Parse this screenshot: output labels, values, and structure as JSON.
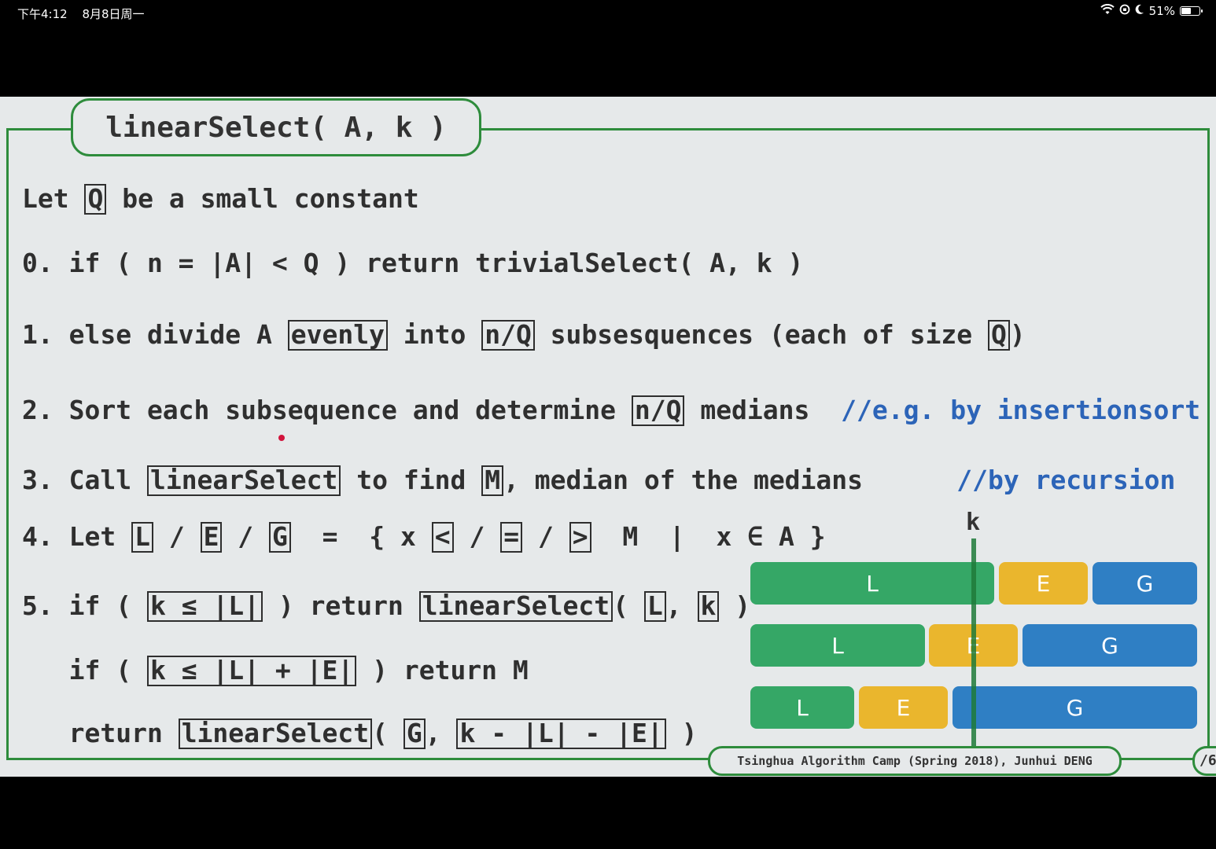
{
  "status": {
    "time": "下午4:12",
    "date": "8月8日周一",
    "battery": "51%"
  },
  "slide": {
    "title": "linearSelect( A, k )",
    "line_let": {
      "a": "Let ",
      "b": "Q",
      "c": " be a small constant"
    },
    "line0": "0. if ( n = |A| < Q ) return trivialSelect( A, k )",
    "line1": {
      "a": "1. else divide A ",
      "b": "evenly",
      "c": " into ",
      "d": "n/Q",
      "e": " subsesquences (each of size ",
      "f": "Q",
      "g": ")"
    },
    "line2": {
      "a": "2. Sort each subsequence and determine ",
      "b": "n/Q",
      "c": " medians  ",
      "comment": "//e.g. by insertionsort"
    },
    "line3": {
      "a": "3. Call ",
      "b": "linearSelect",
      "c": " to find ",
      "d": "M",
      "e": ", median of the medians      ",
      "comment": "//by recursion"
    },
    "line4": {
      "a": "4. Let ",
      "L": "L",
      "s1": " / ",
      "E": "E",
      "s2": " / ",
      "G": "G",
      "b": "  =  { x ",
      "lt": "<",
      "s3": " / ",
      "eq": "=",
      "s4": " / ",
      "gt": ">",
      "c": "  M  |  x ∈ A }"
    },
    "line5": {
      "a": "5. if ( ",
      "b": "k ≤ |L|",
      "c": " ) return ",
      "d": "linearSelect",
      "e": "( ",
      "f": "L",
      "g": ", ",
      "h": "k",
      "i": " )"
    },
    "line6": {
      "a": "   if ( ",
      "b": "k ≤ |L| + |E|",
      "c": " ) return M"
    },
    "line7": {
      "a": "   return ",
      "b": "linearSelect",
      "c": "( ",
      "d": "G",
      "e": ", ",
      "f": "k - |L| - |E|",
      "g": " )"
    },
    "k_label": "k",
    "bars": [
      [
        {
          "label": "L",
          "type": "L"
        },
        {
          "label": "E",
          "type": "E"
        },
        {
          "label": "G",
          "type": "G"
        }
      ],
      [
        {
          "label": "L",
          "type": "L"
        },
        {
          "label": "E",
          "type": "E"
        },
        {
          "label": "G",
          "type": "G"
        }
      ],
      [
        {
          "label": "L",
          "type": "L"
        },
        {
          "label": "E",
          "type": "E"
        },
        {
          "label": "G",
          "type": "G"
        }
      ]
    ],
    "footer": "Tsinghua Algorithm Camp (Spring 2018), Junhui DENG",
    "page": "/6"
  },
  "colors": {
    "frame": "#2e8c3c",
    "L": "#35a766",
    "E": "#eab62d",
    "G": "#2f7fc4",
    "comment": "#2c64b8"
  }
}
